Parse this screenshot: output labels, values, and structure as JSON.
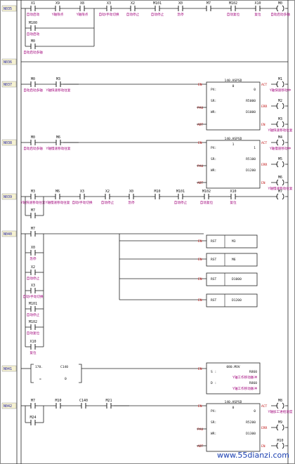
{
  "rungs": [
    {
      "label": "N035",
      "contacts": [
        {
          "name": "X1",
          "note": "自动启动"
        },
        {
          "name": "X9",
          "note": "Y轴限点"
        },
        {
          "name": "X8",
          "note": "Y轴限点"
        },
        {
          "name": "X3",
          "note": "自动/手动切换"
        },
        {
          "name": "X2",
          "note": "自动停止"
        },
        {
          "name": "M101",
          "note": "自动停止"
        },
        {
          "name": "X0",
          "note": "急停"
        },
        {
          "name": "M7",
          "note": ""
        },
        {
          "name": "M102",
          "note": "自动复位"
        },
        {
          "name": "X10",
          "note": "复位"
        }
      ],
      "coil": {
        "name": "M0",
        "note": "自动启动多轴"
      },
      "parallel": [
        {
          "name": "M100",
          "note": "自动启动"
        },
        {
          "name": "M0",
          "note": "自动启动多轴"
        }
      ]
    },
    {
      "label": "N036",
      "contacts": [],
      "parallel": []
    },
    {
      "label": "N037",
      "contacts": [
        {
          "name": "M0",
          "note": "自动启动多轴"
        },
        {
          "name": "M3",
          "note": "Y轴快速移动往复"
        }
      ],
      "box": {
        "title": "140.HSPSD",
        "ch": "0",
        "rows": [
          [
            "PX:",
            "0"
          ],
          [
            "SR:",
            "R5000"
          ],
          [
            "WR:",
            "D1000"
          ]
        ]
      },
      "outs": [
        {
          "name": "M1",
          "note": "Y轴快速移动中"
        },
        {
          "name": "M2",
          "note": ""
        },
        {
          "name": "M3",
          "note": "Y轴快速移动往复"
        }
      ]
    },
    {
      "label": "N038",
      "contacts": [
        {
          "name": "M0",
          "note": "自动启动多轴"
        },
        {
          "name": "M6",
          "note": "Y轴慢速移动往复"
        }
      ],
      "box": {
        "title": "140.HSPSD",
        "ch": "1",
        "rows": [
          [
            "PX:",
            "1"
          ],
          [
            "SR:",
            "R5100"
          ],
          [
            "WR:",
            "D1200"
          ]
        ]
      },
      "outs": [
        {
          "name": "M4",
          "note": "Y轴慢速移动中"
        },
        {
          "name": "M5",
          "note": ""
        },
        {
          "name": "M6",
          "note": "Y轴慢速移动往复"
        }
      ]
    },
    {
      "label": "N039",
      "contacts": [
        {
          "name": "M3",
          "note": "Y轴快速移动往复"
        },
        {
          "name": "M6",
          "note": "Y轴慢速移动往复"
        },
        {
          "name": "X3",
          "note": "自动/手动切换"
        },
        {
          "name": "X2",
          "note": "自动停止"
        },
        {
          "name": "X0",
          "note": "急停"
        },
        {
          "name": "M10",
          "note": ""
        },
        {
          "name": "M101",
          "note": "自动停止"
        },
        {
          "name": "M102",
          "note": "自动复位"
        },
        {
          "name": "X10",
          "note": "复位"
        }
      ],
      "coil": {
        "name": "M7",
        "note": ""
      },
      "parallel": [
        {
          "name": "M7",
          "note": ""
        }
      ]
    },
    {
      "label": "N040",
      "contacts": [
        {
          "name": "M7",
          "note": ""
        }
      ],
      "parallel": [
        {
          "name": "X0",
          "note": "急停"
        },
        {
          "name": "X2",
          "note": "自动停止"
        },
        {
          "name": "X3",
          "note": "自动/手动切换"
        },
        {
          "name": "M101",
          "note": "自动停止"
        },
        {
          "name": "M102",
          "note": "自动复位"
        },
        {
          "name": "X10",
          "note": "复位"
        }
      ],
      "rst": [
        [
          "RST",
          "M3"
        ],
        [
          "RST",
          "M6"
        ],
        [
          "RST",
          "D1000"
        ],
        [
          "RST",
          "D1200"
        ]
      ]
    },
    {
      "label": "N041",
      "compare": {
        "title": "170.",
        "op": "=",
        "a": "C140",
        "b": "0"
      },
      "box": {
        "title": "080.MOV",
        "rows": [
          [
            "S :",
            "R860"
          ],
          [
            "",
            "Y轴工作移动脉冲"
          ],
          [
            "D :",
            "R860"
          ],
          [
            "",
            "Y轴工作移动脉冲"
          ]
        ]
      }
    },
    {
      "label": "N042",
      "contacts": [
        {
          "name": "M7",
          "note": ""
        },
        {
          "name": "M10",
          "note": ""
        },
        {
          "name": "C140",
          "note": ""
        },
        {
          "name": "M21",
          "note": ""
        }
      ],
      "parallel": [
        {
          "name": "M24",
          "note": ""
        }
      ],
      "box": {
        "title": "140.HSPSD",
        "ch": "0",
        "rows": [
          [
            "PX:",
            "0"
          ],
          [
            "SR:",
            "R5200"
          ],
          [
            "WR:",
            "D1300"
          ]
        ]
      },
      "outs": [
        {
          "name": "M8",
          "note": "Y轴加工进给速度"
        },
        {
          "name": "M9",
          "note": ""
        },
        {
          "name": "M10",
          "note": ""
        }
      ]
    }
  ],
  "io_labels": {
    "en": "EN",
    "pau": "PAU",
    "abt": "ABT",
    "act": "ACT",
    "err": "ERR"
  },
  "watermark": "www.55dianzi.com",
  "colors": {
    "line": "#222222",
    "label_bg": "#f6f2d2",
    "note": "#a0007a",
    "io": "#c01818"
  }
}
